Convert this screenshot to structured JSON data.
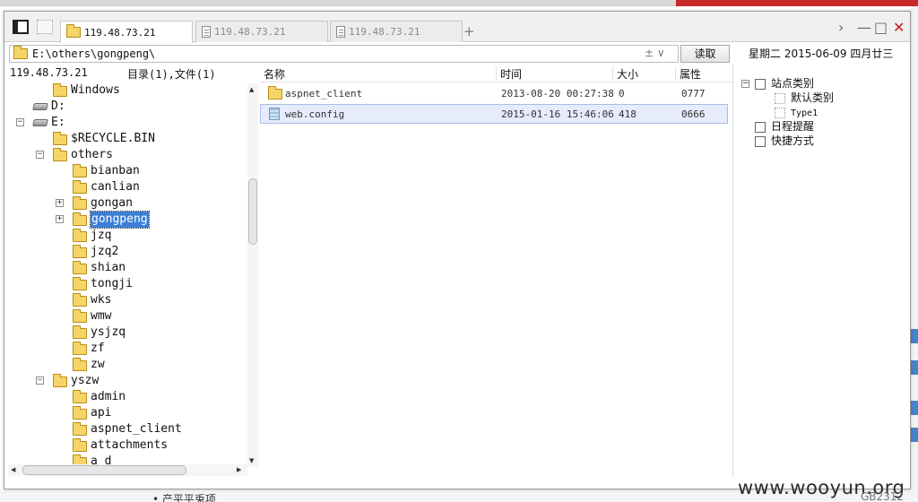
{
  "window": {
    "tabs": [
      {
        "label": "119.48.73.21",
        "icon": "folder-icon",
        "active": true
      },
      {
        "label": "119.48.73.21",
        "icon": "document-icon",
        "active": false
      },
      {
        "label": "119.48.73.21",
        "icon": "document-icon",
        "active": false
      }
    ],
    "add_tab": "+",
    "controls": {
      "next": "›",
      "minimize": "—",
      "maximize": "□",
      "close": "✕"
    }
  },
  "toolbar": {
    "path": "E:\\others\\gongpeng\\",
    "dropdown": "± ∨",
    "read_button": "读取",
    "date": "星期二  2015-06-09  四月廿三"
  },
  "tree": {
    "host": "119.48.73.21",
    "counts": "目录(1),文件(1)",
    "items": [
      {
        "label": "Windows",
        "indent": 1,
        "icon": "folder",
        "toggle": ""
      },
      {
        "label": "D:",
        "indent": 0,
        "icon": "drive",
        "toggle": ""
      },
      {
        "label": "E:",
        "indent": 0,
        "icon": "drive",
        "toggle": "−"
      },
      {
        "label": "$RECYCLE.BIN",
        "indent": 1,
        "icon": "folder",
        "toggle": ""
      },
      {
        "label": "others",
        "indent": 1,
        "icon": "folder",
        "toggle": "−"
      },
      {
        "label": "bianban",
        "indent": 2,
        "icon": "folder",
        "toggle": ""
      },
      {
        "label": "canlian",
        "indent": 2,
        "icon": "folder",
        "toggle": ""
      },
      {
        "label": "gongan",
        "indent": 2,
        "icon": "folder",
        "toggle": "+"
      },
      {
        "label": "gongpeng",
        "indent": 2,
        "icon": "folder",
        "toggle": "+",
        "selected": true
      },
      {
        "label": "jzq",
        "indent": 2,
        "icon": "folder",
        "toggle": ""
      },
      {
        "label": "jzq2",
        "indent": 2,
        "icon": "folder",
        "toggle": ""
      },
      {
        "label": "shian",
        "indent": 2,
        "icon": "folder",
        "toggle": ""
      },
      {
        "label": "tongji",
        "indent": 2,
        "icon": "folder",
        "toggle": ""
      },
      {
        "label": "wks",
        "indent": 2,
        "icon": "folder",
        "toggle": ""
      },
      {
        "label": "wmw",
        "indent": 2,
        "icon": "folder",
        "toggle": ""
      },
      {
        "label": "ysjzq",
        "indent": 2,
        "icon": "folder",
        "toggle": ""
      },
      {
        "label": "zf",
        "indent": 2,
        "icon": "folder",
        "toggle": ""
      },
      {
        "label": "zw",
        "indent": 2,
        "icon": "folder",
        "toggle": ""
      },
      {
        "label": "yszw",
        "indent": 1,
        "icon": "folder",
        "toggle": "−"
      },
      {
        "label": "admin",
        "indent": 2,
        "icon": "folder",
        "toggle": ""
      },
      {
        "label": "api",
        "indent": 2,
        "icon": "folder",
        "toggle": ""
      },
      {
        "label": "aspnet_client",
        "indent": 2,
        "icon": "folder",
        "toggle": ""
      },
      {
        "label": "attachments",
        "indent": 2,
        "icon": "folder",
        "toggle": ""
      },
      {
        "label": "a d",
        "indent": 2,
        "icon": "folder",
        "toggle": ""
      }
    ]
  },
  "file_list": {
    "columns": [
      "名称",
      "时间",
      "大小",
      "属性"
    ],
    "rows": [
      {
        "name": "aspnet_client",
        "type": "folder",
        "time": "2013-08-20 00:27:38",
        "size": "0",
        "attr": "0777",
        "selected": false
      },
      {
        "name": "web.config",
        "type": "config-file",
        "time": "2015-01-16 15:46:06",
        "size": "418",
        "attr": "0666",
        "selected": true
      }
    ]
  },
  "side_panel": {
    "items": [
      {
        "label": "站点类别",
        "toggle": "−",
        "icon": "category-icon"
      },
      {
        "label": "默认类别",
        "icon": "item-icon"
      },
      {
        "label": "Type1",
        "icon": "item-icon"
      },
      {
        "label": "日程提醒",
        "icon": "schedule-icon"
      },
      {
        "label": "快捷方式",
        "icon": "shortcut-icon"
      }
    ]
  },
  "watermark": "www.wooyun.org",
  "bottom_code": "GB2312",
  "background": {
    "bottom_text": "• 产平平兎项"
  }
}
